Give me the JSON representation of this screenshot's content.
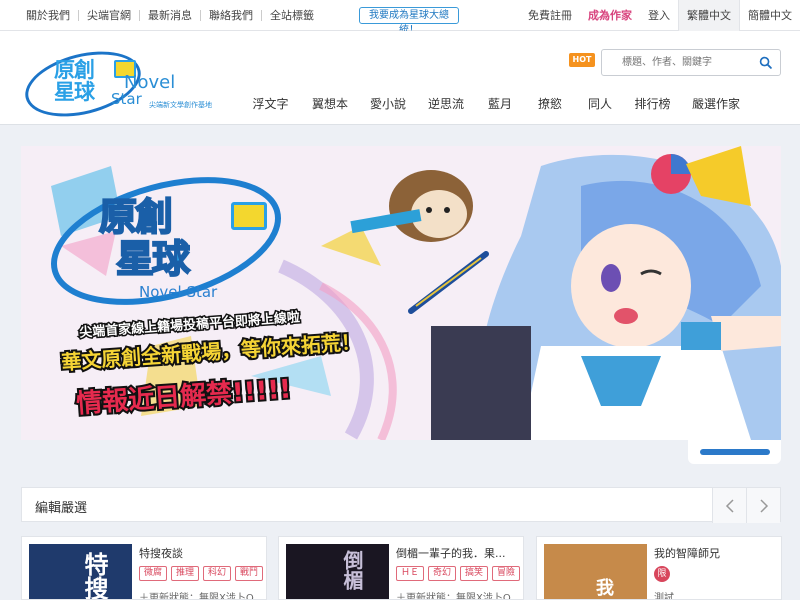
{
  "topbar": {
    "left_links": [
      "關於我們",
      "尖端官網",
      "最新消息",
      "聯絡我們",
      "全站標籤"
    ],
    "cta": "我要成為星球大總統！",
    "register": "免費註冊",
    "be_author": "成為作家",
    "login": "登入",
    "lang_traditional": "繁體中文",
    "lang_simplified": "簡體中文"
  },
  "logo": {
    "cn_line1": "原創",
    "cn_line2": "星球",
    "en_line1": "Novel",
    "en_line2": "Star",
    "subtitle": "尖端新文學創作基地"
  },
  "search": {
    "hot_badge": "HOT",
    "placeholder": "標題、作者、關鍵字",
    "icon": "search-icon"
  },
  "nav": [
    "浮文字",
    "翼想本",
    "愛小說",
    "逆思流",
    "藍月",
    "撩慾",
    "同人",
    "排行榜",
    "嚴選作家"
  ],
  "banner": {
    "logo_cn1": "原創",
    "logo_cn2": "星球",
    "logo_en": "Novel Star",
    "line1": "尖端首家線上籍場投稿平台即將上線啦",
    "line2": "華文原創全新戰場，等你來拓荒！",
    "line3": "情報近日解禁!!!!!"
  },
  "section": {
    "title": "編輯嚴選"
  },
  "cards": [
    {
      "title": "特搜夜談",
      "tags": [
        "微腐",
        "推理",
        "科幻",
        "戰鬥"
      ],
      "desc": "＋更新狀態：無限X涉卜Q",
      "cover_text": "特搜"
    },
    {
      "title": "倒楣一輩子的我．果...",
      "tags": [
        "ＨＥ",
        "奇幻",
        "搞笑",
        "冒險"
      ],
      "desc": "＋更新狀態：無限X涉卜Q",
      "cover_text": "倒楣"
    },
    {
      "title": "我的智障師兄",
      "tags": [
        "限"
      ],
      "desc": "測試",
      "cover_text": "我"
    }
  ],
  "colors": {
    "accent_blue": "#2b79c9",
    "pink": "#d8447e",
    "hot_orange": "#f5921e",
    "tag_red": "#d8465c"
  }
}
